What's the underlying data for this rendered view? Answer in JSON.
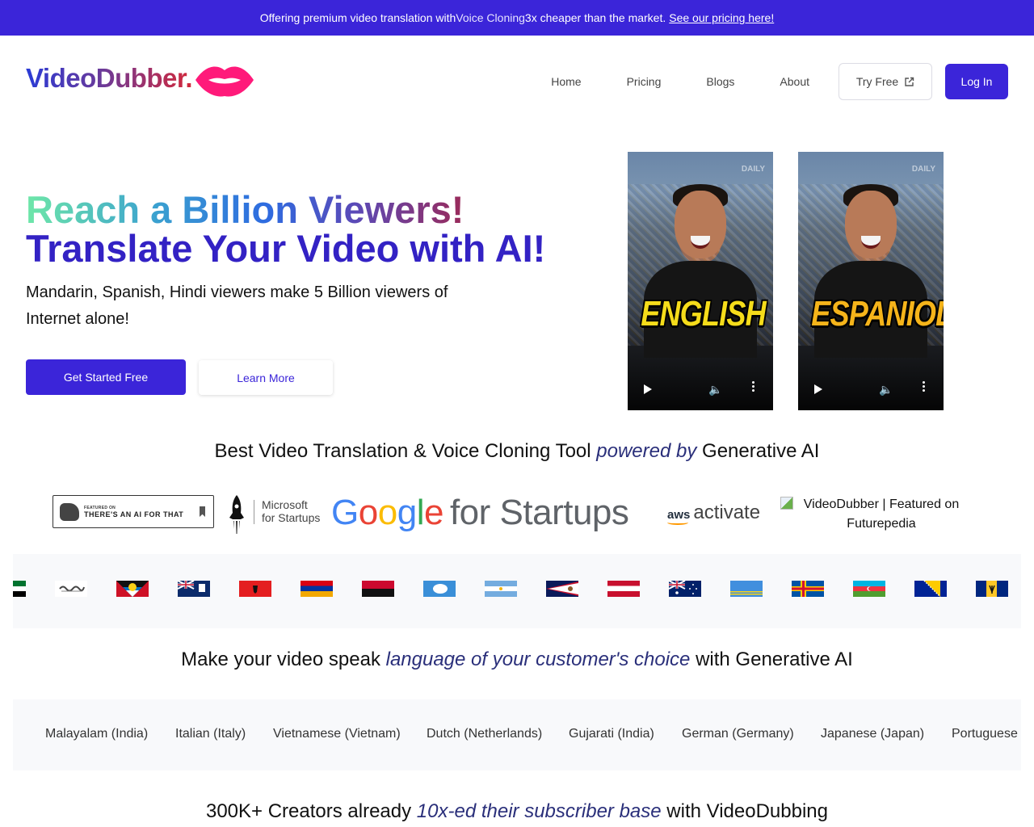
{
  "banner": {
    "text_before": "Offering premium video translation with ",
    "highlight": "Voice Cloning",
    "text_after": " 3x cheaper than the market.",
    "link": "See our pricing here!"
  },
  "header": {
    "logo": "VideoDubber.",
    "nav": [
      "Home",
      "Pricing",
      "Blogs",
      "About"
    ],
    "try_free": "Try Free",
    "login": "Log In"
  },
  "hero": {
    "title_line1": "Reach a Billion Viewers!",
    "title_line2": "Translate Your Video with AI!",
    "subtitle": "Mandarin, Spanish, Hindi viewers make 5 Billion viewers of Internet alone!",
    "cta_primary": "Get Started Free",
    "cta_secondary": "Learn More",
    "videos": [
      {
        "label": "ENGLISH",
        "watermark": "DAILY"
      },
      {
        "label": "ESPANIOL",
        "watermark": "DAILY"
      }
    ]
  },
  "powered": {
    "before": "Best Video Translation & Voice Cloning Tool ",
    "emphasis": "powered by",
    "after": " Generative AI"
  },
  "partners": {
    "taaft_small": "FEATURED ON",
    "taaft_big": "THERE'S AN AI FOR THAT",
    "microsoft_line1": "Microsoft",
    "microsoft_line2": "for Startups",
    "google_parts": [
      "G",
      "o",
      "o",
      "g",
      "l",
      "e"
    ],
    "google_suffix": "for Startups",
    "aws_mark": "aws",
    "aws_text": "activate",
    "futurepedia_alt": "VideoDubber | Featured on Futurepedia"
  },
  "flags": [
    "uae-partial",
    "arabic-script",
    "antigua-barbuda",
    "anguilla",
    "albania",
    "armenia",
    "angola",
    "antarctica",
    "argentina",
    "american-samoa",
    "austria",
    "australia",
    "aruba",
    "aland",
    "azerbaijan",
    "bosnia",
    "barbados"
  ],
  "languages_title": {
    "before": "Make your video speak ",
    "emphasis": "language of your customer's choice",
    "after": " with Generative AI"
  },
  "languages": [
    ")",
    "Malayalam (India)",
    "Italian (Italy)",
    "Vietnamese (Vietnam)",
    "Dutch (Netherlands)",
    "Gujarati (India)",
    "German (Germany)",
    "Japanese (Japan)",
    "Portuguese ("
  ],
  "creators": {
    "before": "300K+ Creators already ",
    "emphasis": "10x-ed their subscriber base",
    "after": " with VideoDubbing"
  },
  "colors": {
    "brand": "#3b25d9",
    "emphasis": "#2a2f7a",
    "lips": "#ff1a7a"
  }
}
